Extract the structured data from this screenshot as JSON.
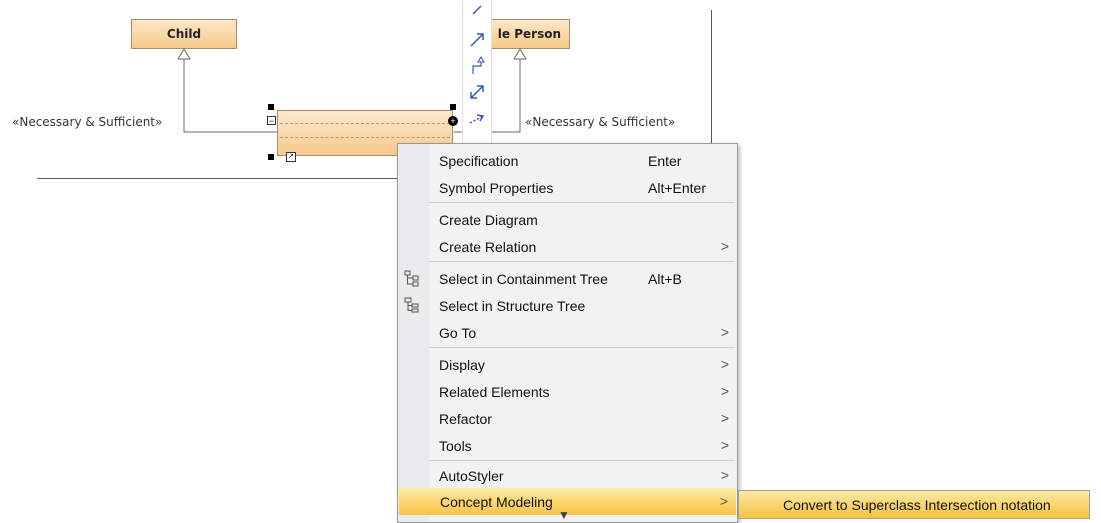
{
  "diagram": {
    "child_class": "Child",
    "person_class": "le Person",
    "stereotype_left": "«Necessary & Sufficient»",
    "stereotype_right": "«Necessary & Sufficient»"
  },
  "toolbar": {
    "icons": [
      "line-icon",
      "directed-association-icon",
      "generalization-icon",
      "dependency-icon",
      "realization-icon"
    ]
  },
  "menu": {
    "items": [
      {
        "label": "Specification",
        "shortcut": "Enter",
        "arrow": ""
      },
      {
        "label": "Symbol Properties",
        "shortcut": "Alt+Enter",
        "arrow": ""
      },
      {
        "label": "Create Diagram",
        "shortcut": "",
        "arrow": ""
      },
      {
        "label": "Create Relation",
        "shortcut": "",
        "arrow": ">"
      },
      {
        "label": "Select in Containment Tree",
        "shortcut": "Alt+B",
        "arrow": "",
        "icon": "containment-tree-icon"
      },
      {
        "label": "Select in Structure Tree",
        "shortcut": "",
        "arrow": "",
        "icon": "structure-tree-icon"
      },
      {
        "label": "Go To",
        "shortcut": "",
        "arrow": ">"
      },
      {
        "label": "Display",
        "shortcut": "",
        "arrow": ">"
      },
      {
        "label": "Related Elements",
        "shortcut": "",
        "arrow": ">"
      },
      {
        "label": "Refactor",
        "shortcut": "",
        "arrow": ">"
      },
      {
        "label": "Tools",
        "shortcut": "",
        "arrow": ">"
      },
      {
        "label": "AutoStyler",
        "shortcut": "",
        "arrow": ">"
      },
      {
        "label": "Concept Modeling",
        "shortcut": "",
        "arrow": ">"
      }
    ],
    "more_indicator": "▼"
  },
  "submenu": {
    "items": [
      {
        "label": "Convert to Superclass Intersection notation"
      }
    ]
  },
  "colors": {
    "class_fill_top": "#fde7c8",
    "class_fill_bottom": "#f7c98a",
    "highlight_top": "#fde9a6",
    "highlight_bottom": "#f9c543"
  }
}
